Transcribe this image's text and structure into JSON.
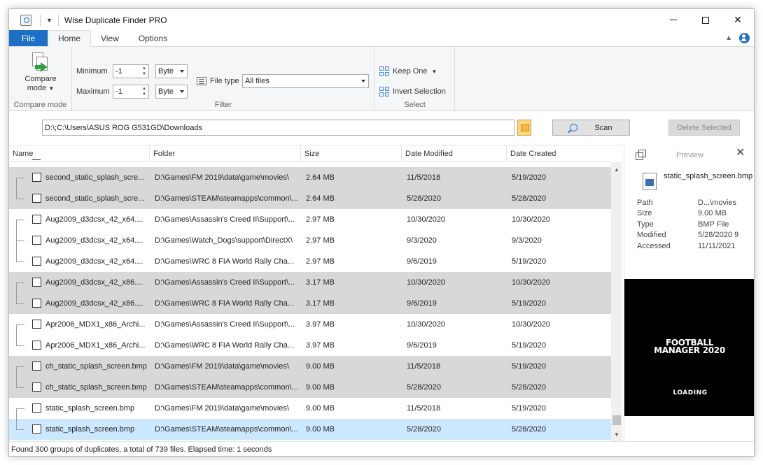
{
  "window": {
    "title": "Wise Duplicate Finder PRO"
  },
  "tabs": [
    {
      "label": "File"
    },
    {
      "label": "Home"
    },
    {
      "label": "View"
    },
    {
      "label": "Options"
    }
  ],
  "ribbon": {
    "compare_mode": {
      "button_line1": "Compare",
      "button_line2": "mode",
      "group_label": "Compare mode"
    },
    "filter": {
      "group_label": "Filter",
      "minimum_label": "Minimum",
      "minimum_value": "-1",
      "minimum_unit": "Byte",
      "maximum_label": "Maximum",
      "maximum_value": "-1",
      "maximum_unit": "Byte",
      "file_type_label": "File type",
      "file_type_value": "All files"
    },
    "select": {
      "group_label": "Select",
      "keep_one": "Keep One",
      "invert_selection": "Invert Selection"
    }
  },
  "pathbar": {
    "path": "D:\\;C:\\Users\\ASUS ROG G531GD\\Downloads",
    "scan_label": "Scan",
    "delete_label": "Delete Selected"
  },
  "table": {
    "columns": [
      "Name",
      "Folder",
      "Size",
      "Date Modified",
      "Date Created"
    ],
    "rows": [
      {
        "name": "second_static_splash_scre...",
        "folder": "D:\\Games\\FM 2019\\data\\game\\movies\\",
        "size": "2.64 MB",
        "modified": "11/5/2018",
        "created": "5/19/2020"
      },
      {
        "name": "second_static_splash_scre...",
        "folder": "D:\\Games\\STEAM\\steamapps\\common\\...",
        "size": "2.64 MB",
        "modified": "5/28/2020",
        "created": "5/28/2020"
      },
      {
        "name": "Aug2009_d3dcsx_42_x64....",
        "folder": "D:\\Games\\Assassin's Creed II\\Support\\...",
        "size": "2.97 MB",
        "modified": "10/30/2020",
        "created": "10/30/2020"
      },
      {
        "name": "Aug2009_d3dcsx_42_x64....",
        "folder": "D:\\Games\\Watch_Dogs\\support\\DirectX\\",
        "size": "2.97 MB",
        "modified": "9/3/2020",
        "created": "9/3/2020"
      },
      {
        "name": "Aug2009_d3dcsx_42_x64....",
        "folder": "D:\\Games\\WRC 8 FIA World Rally Cha...",
        "size": "2.97 MB",
        "modified": "9/6/2019",
        "created": "5/19/2020"
      },
      {
        "name": "Aug2009_d3dcsx_42_x86....",
        "folder": "D:\\Games\\Assassin's Creed II\\Support\\...",
        "size": "3.17 MB",
        "modified": "10/30/2020",
        "created": "10/30/2020"
      },
      {
        "name": "Aug2009_d3dcsx_42_x86....",
        "folder": "D:\\Games\\WRC 8 FIA World Rally Cha...",
        "size": "3.17 MB",
        "modified": "9/6/2019",
        "created": "5/19/2020"
      },
      {
        "name": "Apr2006_MDX1_x86_Archi...",
        "folder": "D:\\Games\\Assassin's Creed II\\Support\\...",
        "size": "3.97 MB",
        "modified": "10/30/2020",
        "created": "10/30/2020"
      },
      {
        "name": "Apr2006_MDX1_x86_Archi...",
        "folder": "D:\\Games\\WRC 8 FIA World Rally Cha...",
        "size": "3.97 MB",
        "modified": "9/6/2019",
        "created": "5/19/2020"
      },
      {
        "name": "ch_static_splash_screen.bmp",
        "folder": "D:\\Games\\FM 2019\\data\\game\\movies\\",
        "size": "9.00 MB",
        "modified": "11/5/2018",
        "created": "5/19/2020"
      },
      {
        "name": "ch_static_splash_screen.bmp",
        "folder": "D:\\Games\\STEAM\\steamapps\\common\\...",
        "size": "9.00 MB",
        "modified": "5/28/2020",
        "created": "5/28/2020"
      },
      {
        "name": "static_splash_screen.bmp",
        "folder": "D:\\Games\\FM 2019\\data\\game\\movies\\",
        "size": "9.00 MB",
        "modified": "11/5/2018",
        "created": "5/19/2020"
      },
      {
        "name": "static_splash_screen.bmp",
        "folder": "D:\\Games\\STEAM\\steamapps\\common\\...",
        "size": "9.00 MB",
        "modified": "5/28/2020",
        "created": "5/28/2020"
      }
    ]
  },
  "preview": {
    "title": "Preview",
    "filename": "static_splash_screen.bmp",
    "meta": [
      {
        "key": "Path",
        "value": "D...\\movies"
      },
      {
        "key": "Size",
        "value": "9.00 MB"
      },
      {
        "key": "Type",
        "value": "BMP File"
      },
      {
        "key": "Modified",
        "value": "5/28/2020 9"
      },
      {
        "key": "Accessed",
        "value": "11/11/2021"
      }
    ],
    "image_title_line1": "FOOTBALL",
    "image_title_line2": "MANAGER 2020",
    "image_caption": "LOADING"
  },
  "status": {
    "text": "Found 300 groups of duplicates, a total of 739 files. Elapsed time: 1 seconds"
  }
}
